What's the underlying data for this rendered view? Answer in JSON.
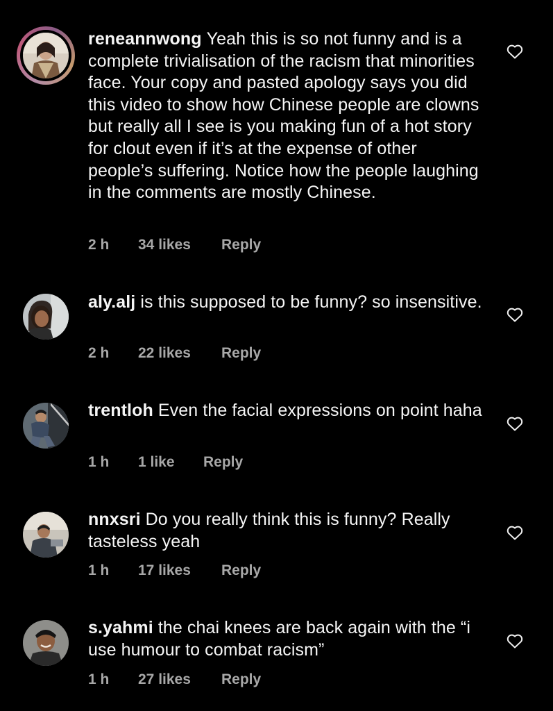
{
  "comments": [
    {
      "username": "reneannwong",
      "text": "Yeah this is so not funny and is a complete trivialisation of the racism that minorities face. Your copy and pasted apology says you did this video to show how Chinese people are clowns but really all I see is you making fun of a hot story for clout even if it’s at the expense of other people’s suffering. Notice how the people laughing in the comments are mostly Chinese.",
      "time": "2 h",
      "likes": "34 likes",
      "reply": "Reply"
    },
    {
      "username": "aly.alj",
      "text": "is this supposed to be funny? so insensitive.",
      "time": "2 h",
      "likes": "22 likes",
      "reply": "Reply"
    },
    {
      "username": "trentloh",
      "text": "Even the facial expressions on point haha",
      "time": "1 h",
      "likes": "1 like",
      "reply": "Reply"
    },
    {
      "username": "nnxsri",
      "text": "Do you really think this is funny? Really tasteless yeah",
      "time": "1 h",
      "likes": "17 likes",
      "reply": "Reply"
    },
    {
      "username": "s.yahmi",
      "text": "the chai knees are back again with the “i use humour to combat racism”",
      "time": "1 h",
      "likes": "27 likes",
      "reply": "Reply"
    }
  ],
  "icons": {
    "like": "heart-outline-icon"
  },
  "colors": {
    "background": "#000000",
    "text": "#f5f5f5",
    "meta": "#a8a8a8"
  }
}
